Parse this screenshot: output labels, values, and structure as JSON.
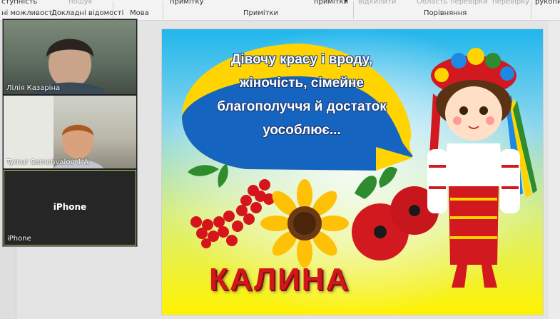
{
  "ribbon": {
    "accessibility": "ступність",
    "search": "пошук",
    "tab_options": "ні можливості",
    "tab_details": "Докладні відомості",
    "language_group": "Мова",
    "note_left": "примітку",
    "notes_group": "Примітки",
    "note_right": "примітки",
    "show_changes": "відкилити",
    "changes_area": "Область перевірки",
    "check": "перевірку",
    "compare_group": "Порівняння",
    "handwriting": "рукопис"
  },
  "participants": [
    {
      "name": "Лілія Казаріна"
    },
    {
      "name": "Tymur Samohvalov 4-А"
    },
    {
      "name": "iPhone",
      "center_label": "iPhone"
    }
  ],
  "slide": {
    "bubble_lines": [
      "Дівочу красу і вроду,",
      "жіночість, сімейне",
      "благополуччя й достаток",
      "уособлює..."
    ],
    "title": "КАЛИНА"
  }
}
